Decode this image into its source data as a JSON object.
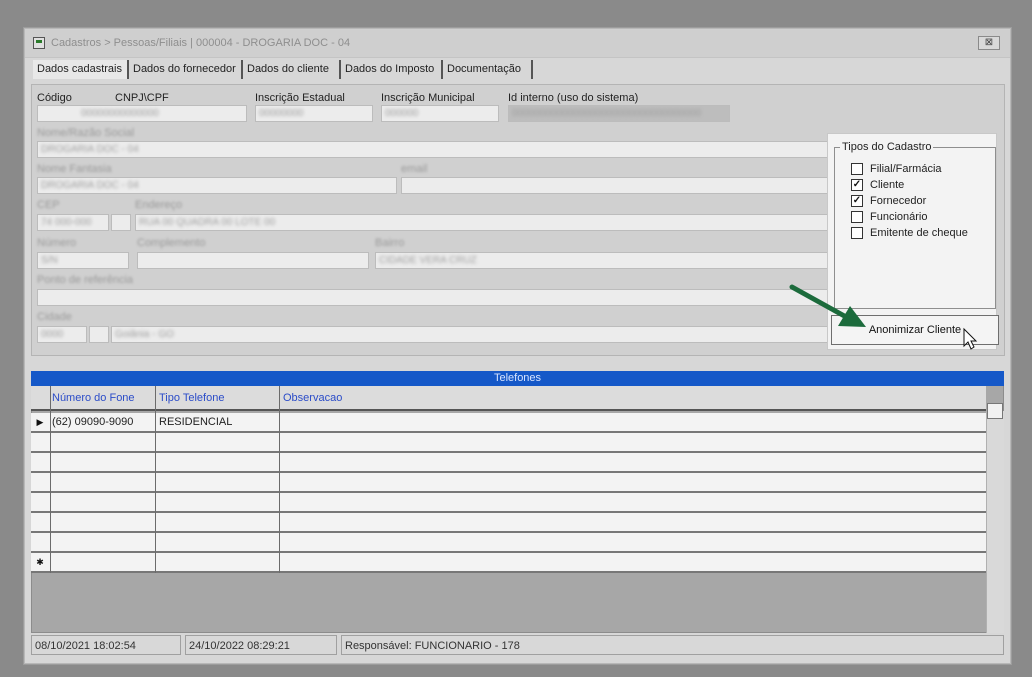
{
  "window": {
    "title": "Cadastros > Pessoas/Filiais | 000004 - DROGARIA DOC - 04",
    "close_glyph": "⊠"
  },
  "tabs": [
    {
      "label": "Dados cadastrais",
      "active": true
    },
    {
      "label": "Dados do fornecedor",
      "active": false
    },
    {
      "label": "Dados do cliente",
      "active": false
    },
    {
      "label": "Dados do Imposto",
      "active": false
    },
    {
      "label": "Documentação",
      "active": false
    }
  ],
  "form": {
    "codigo_label": "Código",
    "cnpj_label": "CNPJ\\CPF",
    "ie_label": "Inscrição Estadual",
    "im_label": "Inscrição Municipal",
    "id_label": "Id interno (uso do sistema)",
    "codigo_value": "00",
    "cnpj_value": "00000000000000",
    "ie_value": "00000000",
    "im_value": "000000",
    "id_value": "0000000000000000000000000000000000",
    "nome_label": "Nome/Razão Social",
    "nome_value": "DROGARIA DOC - 04",
    "fantasia_label": "Nome Fantasia",
    "fantasia_value": "DROGARIA DOC - 04",
    "email_label": "email",
    "email_value": "",
    "cep_label": "CEP",
    "cep_value": "74 000-000",
    "endereco_label": "Endereço",
    "endereco_value": "RUA 00 QUADRA 00 LOTE 00",
    "numero_label": "Número",
    "numero_value": "S/N",
    "complemento_label": "Complemento",
    "complemento_value": "",
    "bairro_label": "Bairro",
    "bairro_value": "CIDADE VERA CRUZ",
    "referencia_label": "Ponto de referência",
    "referencia_value": "",
    "cidade_label": "Cidade",
    "cidade_code": "0000",
    "cidade_value": "Goiânia - GO"
  },
  "tipos": {
    "title": "Tipos do Cadastro",
    "items": [
      {
        "label": "Filial/Farmácia",
        "checked": false
      },
      {
        "label": "Cliente",
        "checked": true
      },
      {
        "label": "Fornecedor",
        "checked": true
      },
      {
        "label": "Funcionário",
        "checked": false
      },
      {
        "label": "Emitente de cheque",
        "checked": false
      }
    ],
    "anon_button": "Anonimizar Cliente"
  },
  "telefones": {
    "title": "Telefones",
    "columns": [
      "Número do Fone",
      "Tipo Telefone",
      "Observacao"
    ],
    "rows": [
      {
        "numero": "(62) 09090-9090",
        "tipo": "RESIDENCIAL",
        "obs": ""
      }
    ],
    "current_row_glyph": "▶",
    "new_row_glyph": "✱"
  },
  "status": {
    "created": "08/10/2021 18:02:54",
    "modified": "24/10/2022 08:29:21",
    "responsavel": "Responsável: FUNCIONARIO - 178"
  }
}
